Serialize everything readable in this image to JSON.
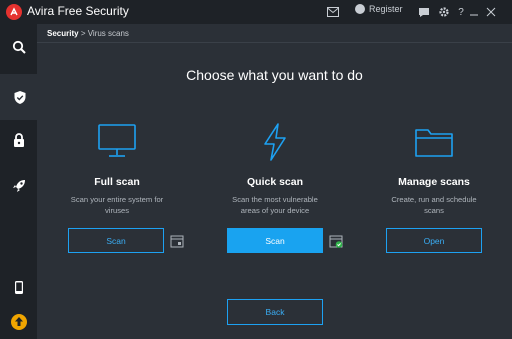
{
  "titlebar": {
    "app_title": "Avira Free Security",
    "register_label": "Register",
    "icons": [
      "mail-icon",
      "user-icon",
      "chat-icon",
      "gear-icon",
      "help-icon",
      "minimize-icon",
      "close-icon"
    ]
  },
  "sidebar": {
    "items": [
      {
        "name": "search-scan",
        "icon": "search-icon"
      },
      {
        "name": "security",
        "icon": "shield-icon",
        "active": true
      },
      {
        "name": "privacy",
        "icon": "lock-icon"
      },
      {
        "name": "performance",
        "icon": "rocket-icon"
      },
      {
        "name": "mobile",
        "icon": "phone-icon"
      },
      {
        "name": "upgrade",
        "icon": "upgrade-icon"
      }
    ]
  },
  "breadcrumb": {
    "root": "Security",
    "separator": ">",
    "current": "Virus scans"
  },
  "main": {
    "heading": "Choose what you want to do",
    "options": [
      {
        "title": "Full scan",
        "desc_line1": "Scan your entire system for",
        "desc_line2": "viruses",
        "button": "Scan",
        "icon": "monitor-icon"
      },
      {
        "title": "Quick scan",
        "desc_line1": "Scan the most vulnerable",
        "desc_line2": "areas of your device",
        "button": "Scan",
        "icon": "lightning-icon"
      },
      {
        "title": "Manage scans",
        "desc_line1": "Create, run and schedule",
        "desc_line2": "scans",
        "button": "Open",
        "icon": "folder-icon"
      }
    ],
    "back_button": "Back"
  },
  "colors": {
    "accent": "#19a3f0",
    "brand": "#e5322f",
    "background": "#2b3037",
    "sidebar": "#1e2227"
  }
}
